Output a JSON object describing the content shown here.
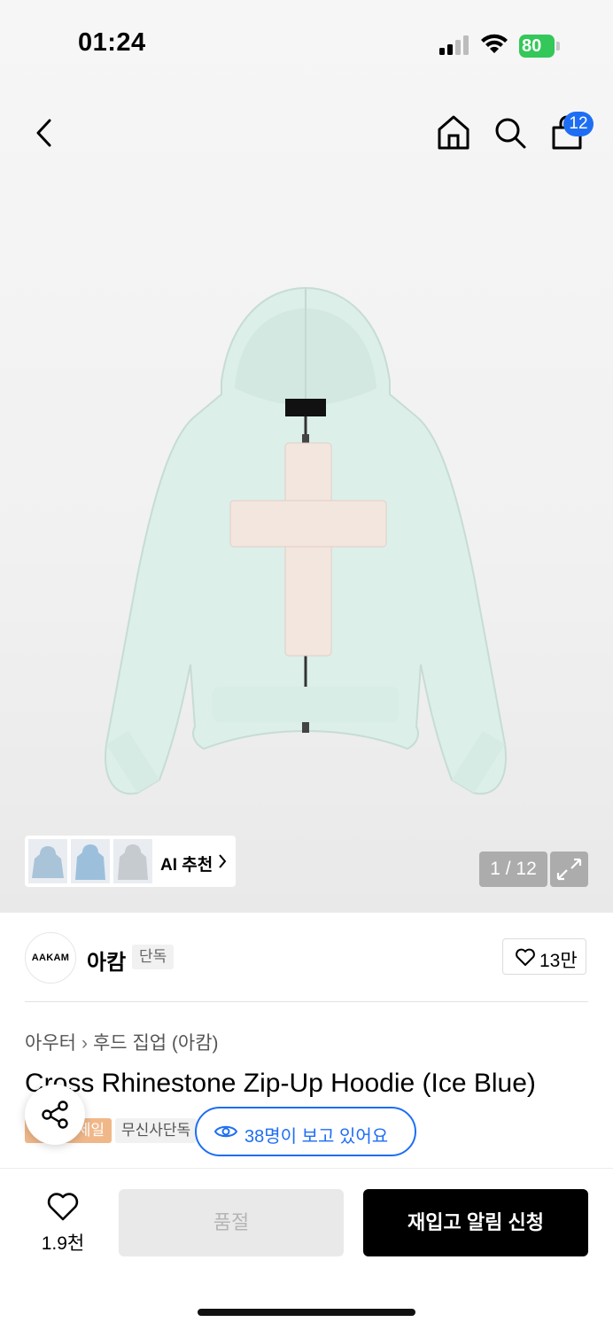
{
  "status_bar": {
    "time": "01:24",
    "battery": "80"
  },
  "nav": {
    "cart_count": "12"
  },
  "gallery": {
    "ai_label": "AI 추천",
    "pager": "1 / 12",
    "logo_tag": "AAKAM"
  },
  "brand": {
    "logo_text": "AAKAM",
    "name": "아캄",
    "tag": "단독",
    "likes": "13만"
  },
  "breadcrumb": {
    "category": "아우터",
    "subcategory": "후드 집업 (아캄)"
  },
  "product": {
    "title": "Cross Rhinestone Zip-Up Hoodie (Ice Blue)"
  },
  "tags": {
    "sale": "세일",
    "exclusive": "무신사단독"
  },
  "viewers": {
    "text": "38명이 보고 있어요"
  },
  "bottom_bar": {
    "wish_count": "1.9천",
    "soldout_label": "품절",
    "restock_label": "재입고 알림 신청"
  },
  "colors": {
    "accent_blue": "#1e6ef4",
    "battery_green": "#34c759",
    "sale_orange": "#f0b889"
  }
}
